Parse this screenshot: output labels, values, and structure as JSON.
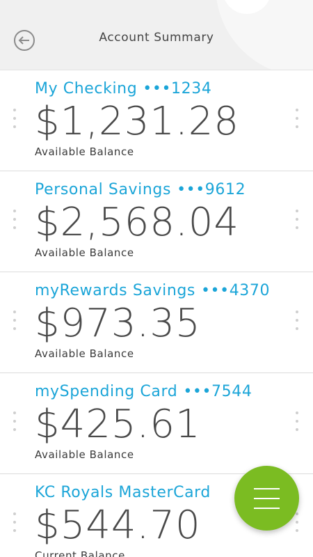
{
  "header": {
    "title": "Account Summary",
    "back_icon": "back-arrow-circle-icon"
  },
  "accounts": [
    {
      "name": "My Checking",
      "mask": "•••1234",
      "amount": "$1,231.28",
      "label": "Available Balance"
    },
    {
      "name": "Personal Savings",
      "mask": "•••9612",
      "amount": "$2,568.04",
      "label": "Available Balance"
    },
    {
      "name": "myRewards Savings",
      "mask": "•••4370",
      "amount": "$973.35",
      "label": "Available Balance"
    },
    {
      "name": "mySpending Card",
      "mask": "•••7544",
      "amount": "$425.61",
      "label": "Available Balance"
    },
    {
      "name": "KC Royals MasterCard",
      "mask": "",
      "amount": "$544.70",
      "label": "Current Balance"
    }
  ],
  "fab": {
    "icon": "hamburger-menu-icon"
  },
  "colors": {
    "accent": "#1ba5d8",
    "fab": "#7bbc22",
    "header_bg": "#f0f0f0"
  }
}
